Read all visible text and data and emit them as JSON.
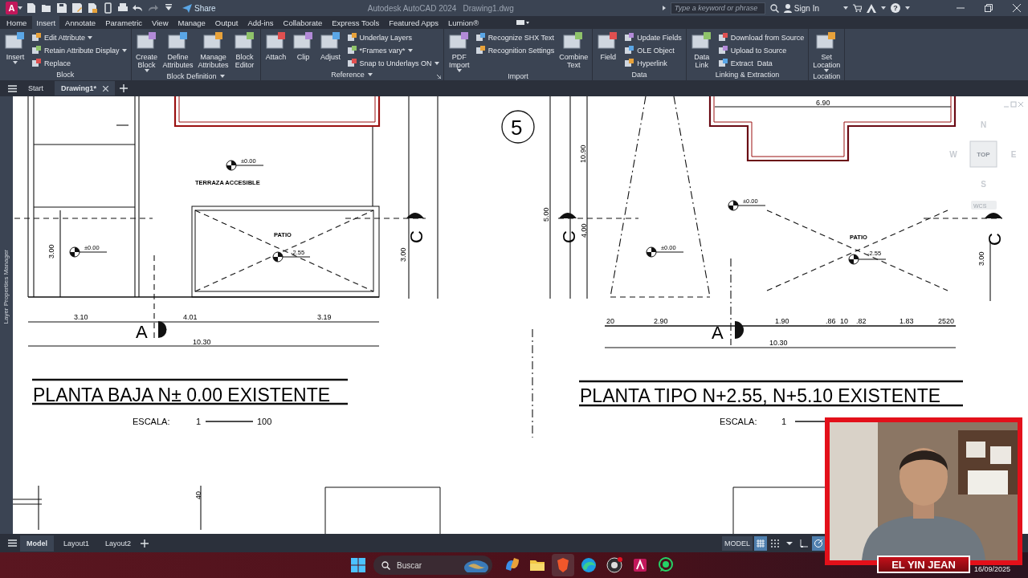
{
  "title_bar": {
    "app_badge": "A",
    "quick_access": [
      {
        "kind": "new",
        "disabled": false
      },
      {
        "kind": "open",
        "disabled": false
      },
      {
        "kind": "save",
        "disabled": false
      },
      {
        "kind": "save-as",
        "disabled": false
      },
      {
        "kind": "publish",
        "disabled": false
      },
      {
        "kind": "mobile",
        "disabled": false
      },
      {
        "kind": "print",
        "disabled": false
      },
      {
        "kind": "undo",
        "disabled": false
      },
      {
        "kind": "redo",
        "disabled": true
      },
      {
        "kind": "customize",
        "disabled": false
      }
    ],
    "share": "Share",
    "app_title": "Autodesk AutoCAD 2024",
    "file_name": "Drawing1.dwg",
    "search": {
      "placeholder": "Type a keyword or phrase"
    },
    "sign_in": "Sign In",
    "help": "?"
  },
  "ribbon": {
    "tabs": [
      {
        "label": "Home",
        "selected": false
      },
      {
        "label": "Insert",
        "selected": true
      },
      {
        "label": "Annotate",
        "selected": false
      },
      {
        "label": "Parametric",
        "selected": false
      },
      {
        "label": "View",
        "selected": false
      },
      {
        "label": "Manage",
        "selected": false
      },
      {
        "label": "Output",
        "selected": false
      },
      {
        "label": "Add-ins",
        "selected": false
      },
      {
        "label": "Collaborate",
        "selected": false
      },
      {
        "label": "Express Tools",
        "selected": false
      },
      {
        "label": "Featured Apps",
        "selected": false
      },
      {
        "label": "Lumion®",
        "selected": false
      }
    ],
    "panels": [
      {
        "title": "Block",
        "has_menu": false,
        "has_launcher": false,
        "items": [
          {
            "kind": "large",
            "label": "Insert",
            "has_menu": true
          },
          {
            "kind": "small",
            "label": "Edit Attribute",
            "has_menu": true
          },
          {
            "kind": "small",
            "label": "Retain Attribute Display",
            "has_menu": true
          },
          {
            "kind": "small",
            "label": "Replace",
            "has_menu": false
          }
        ]
      },
      {
        "title": "Block Definition",
        "has_menu": true,
        "has_launcher": false,
        "items": [
          {
            "kind": "large",
            "label": "Create Block",
            "has_menu": true
          },
          {
            "kind": "large",
            "label": "Define Attributes",
            "has_menu": false
          },
          {
            "kind": "large",
            "label": "Manage Attributes",
            "has_menu": false
          },
          {
            "kind": "large",
            "label": "Block Editor",
            "has_menu": false
          }
        ]
      },
      {
        "title": "Reference",
        "has_menu": true,
        "has_launcher": true,
        "items": [
          {
            "kind": "large",
            "label": "Attach",
            "has_menu": false
          },
          {
            "kind": "large",
            "label": "Clip",
            "has_menu": false
          },
          {
            "kind": "large",
            "label": "Adjust",
            "has_menu": false
          },
          {
            "kind": "small",
            "label": "Underlay Layers",
            "has_menu": false
          },
          {
            "kind": "small",
            "label": "*Frames vary*",
            "has_menu": true
          },
          {
            "kind": "small",
            "label": "Snap to Underlays ON",
            "has_menu": true
          }
        ]
      },
      {
        "title": "Import",
        "has_menu": false,
        "has_launcher": false,
        "items": [
          {
            "kind": "large",
            "label": "PDF Import",
            "has_menu": true
          },
          {
            "kind": "small",
            "label": "Recognize SHX Text",
            "has_menu": false
          },
          {
            "kind": "small",
            "label": "Recognition Settings",
            "has_menu": false
          },
          {
            "kind": "large",
            "label": "Combine Text",
            "has_menu": false
          }
        ]
      },
      {
        "title": "Data",
        "has_menu": false,
        "has_launcher": false,
        "items": [
          {
            "kind": "large",
            "label": "Field",
            "has_menu": false
          },
          {
            "kind": "small",
            "label": "Update Fields",
            "has_menu": false
          },
          {
            "kind": "small",
            "label": "OLE Object",
            "has_menu": false
          },
          {
            "kind": "small",
            "label": "Hyperlink",
            "has_menu": false
          }
        ]
      },
      {
        "title": "Linking & Extraction",
        "has_menu": false,
        "has_launcher": false,
        "items": [
          {
            "kind": "large",
            "label": "Data Link",
            "has_menu": false
          },
          {
            "kind": "small",
            "label": "Download from Source",
            "has_menu": false
          },
          {
            "kind": "small",
            "label": "Upload to Source",
            "has_menu": false
          },
          {
            "kind": "small",
            "label": "Extract  Data",
            "has_menu": false
          }
        ]
      },
      {
        "title": "Location",
        "has_menu": false,
        "has_launcher": false,
        "items": [
          {
            "kind": "large",
            "label": "Set Location",
            "has_menu": true
          }
        ]
      }
    ]
  },
  "file_tabs": [
    {
      "label": "Start",
      "selected": false,
      "closable": false
    },
    {
      "label": "Drawing1*",
      "selected": true,
      "closable": true
    }
  ],
  "side_palette": {
    "label": "Layer Properties Manager"
  },
  "drawing": {
    "texts": [
      {
        "kind": "label",
        "text": "TERRAZA ACCESIBLE"
      },
      {
        "kind": "level",
        "text": "±0.00"
      },
      {
        "kind": "level",
        "text": "±0.00"
      },
      {
        "kind": "label",
        "text": "PATIO"
      },
      {
        "kind": "level",
        "text": "-2.55"
      },
      {
        "kind": "dimension",
        "text": "3.00"
      },
      {
        "kind": "dimension",
        "text": "3.00"
      },
      {
        "kind": "dimension",
        "text": "3.10"
      },
      {
        "kind": "dimension",
        "text": "4.01"
      },
      {
        "kind": "dimension",
        "text": "3.19"
      },
      {
        "kind": "dimension",
        "text": "10.30"
      },
      {
        "kind": "section",
        "text": "A"
      },
      {
        "kind": "section",
        "text": "C"
      },
      {
        "kind": "title",
        "text": "PLANTA BAJA N± 0.00  EXISTENTE"
      },
      {
        "kind": "scale",
        "text": "ESCALA:"
      },
      {
        "kind": "scale",
        "text": "1"
      },
      {
        "kind": "scale",
        "text": "100"
      },
      {
        "kind": "bubble",
        "text": "5"
      },
      {
        "kind": "dimension",
        "text": "10.90"
      },
      {
        "kind": "dimension",
        "text": "5.00"
      },
      {
        "kind": "dimension",
        "text": "4.00"
      },
      {
        "kind": "section",
        "text": "C"
      },
      {
        "kind": "level",
        "text": "±0.00"
      },
      {
        "kind": "level",
        "text": "±0.00"
      },
      {
        "kind": "label",
        "text": "PATIO"
      },
      {
        "kind": "level",
        "text": "-2.55"
      },
      {
        "kind": "dimension",
        "text": "3.00"
      },
      {
        "kind": "section",
        "text": "C"
      },
      {
        "kind": "dimension",
        "text": "6.90"
      },
      {
        "kind": "dimension",
        "text": "20"
      },
      {
        "kind": "dimension",
        "text": "2.90"
      },
      {
        "kind": "dimension",
        "text": "1.90"
      },
      {
        "kind": "dimension",
        "text": ".86"
      },
      {
        "kind": "dimension",
        "text": "10"
      },
      {
        "kind": "dimension",
        "text": ".82"
      },
      {
        "kind": "dimension",
        "text": "1.83"
      },
      {
        "kind": "dimension",
        "text": "2520"
      },
      {
        "kind": "section",
        "text": "A"
      },
      {
        "kind": "dimension",
        "text": "10.30"
      },
      {
        "kind": "title",
        "text": "PLANTA TIPO N+2.55, N+5.10 EXISTENTE"
      },
      {
        "kind": "scale",
        "text": "ESCALA:"
      },
      {
        "kind": "scale",
        "text": "1"
      },
      {
        "kind": "dimension",
        "text": "40"
      }
    ]
  },
  "view_cube": {
    "face": "TOP",
    "north": "N",
    "west": "W",
    "east": "E",
    "south": "S",
    "ucs": "WCS"
  },
  "layout_tabs": [
    {
      "label": "Model",
      "selected": true
    },
    {
      "label": "Layout1",
      "selected": false
    },
    {
      "label": "Layout2",
      "selected": false
    }
  ],
  "status_bar": {
    "mode": "MODEL",
    "grid_on": true,
    "snap_on": false,
    "ortho_on": false,
    "polar_on": true
  },
  "taskbar": {
    "search_placeholder": "Buscar",
    "apps": [
      {
        "kind": "copilot",
        "selected": false
      },
      {
        "kind": "folder",
        "selected": false
      },
      {
        "kind": "brave",
        "selected": true
      },
      {
        "kind": "edge",
        "selected": false
      },
      {
        "kind": "obs",
        "selected": false
      },
      {
        "kind": "autocad",
        "selected": false
      },
      {
        "kind": "whatsapp",
        "selected": false
      }
    ],
    "date": "16/09/2025"
  },
  "webcam": {
    "kind": "picture",
    "caption": "EL YIN JEAN"
  }
}
